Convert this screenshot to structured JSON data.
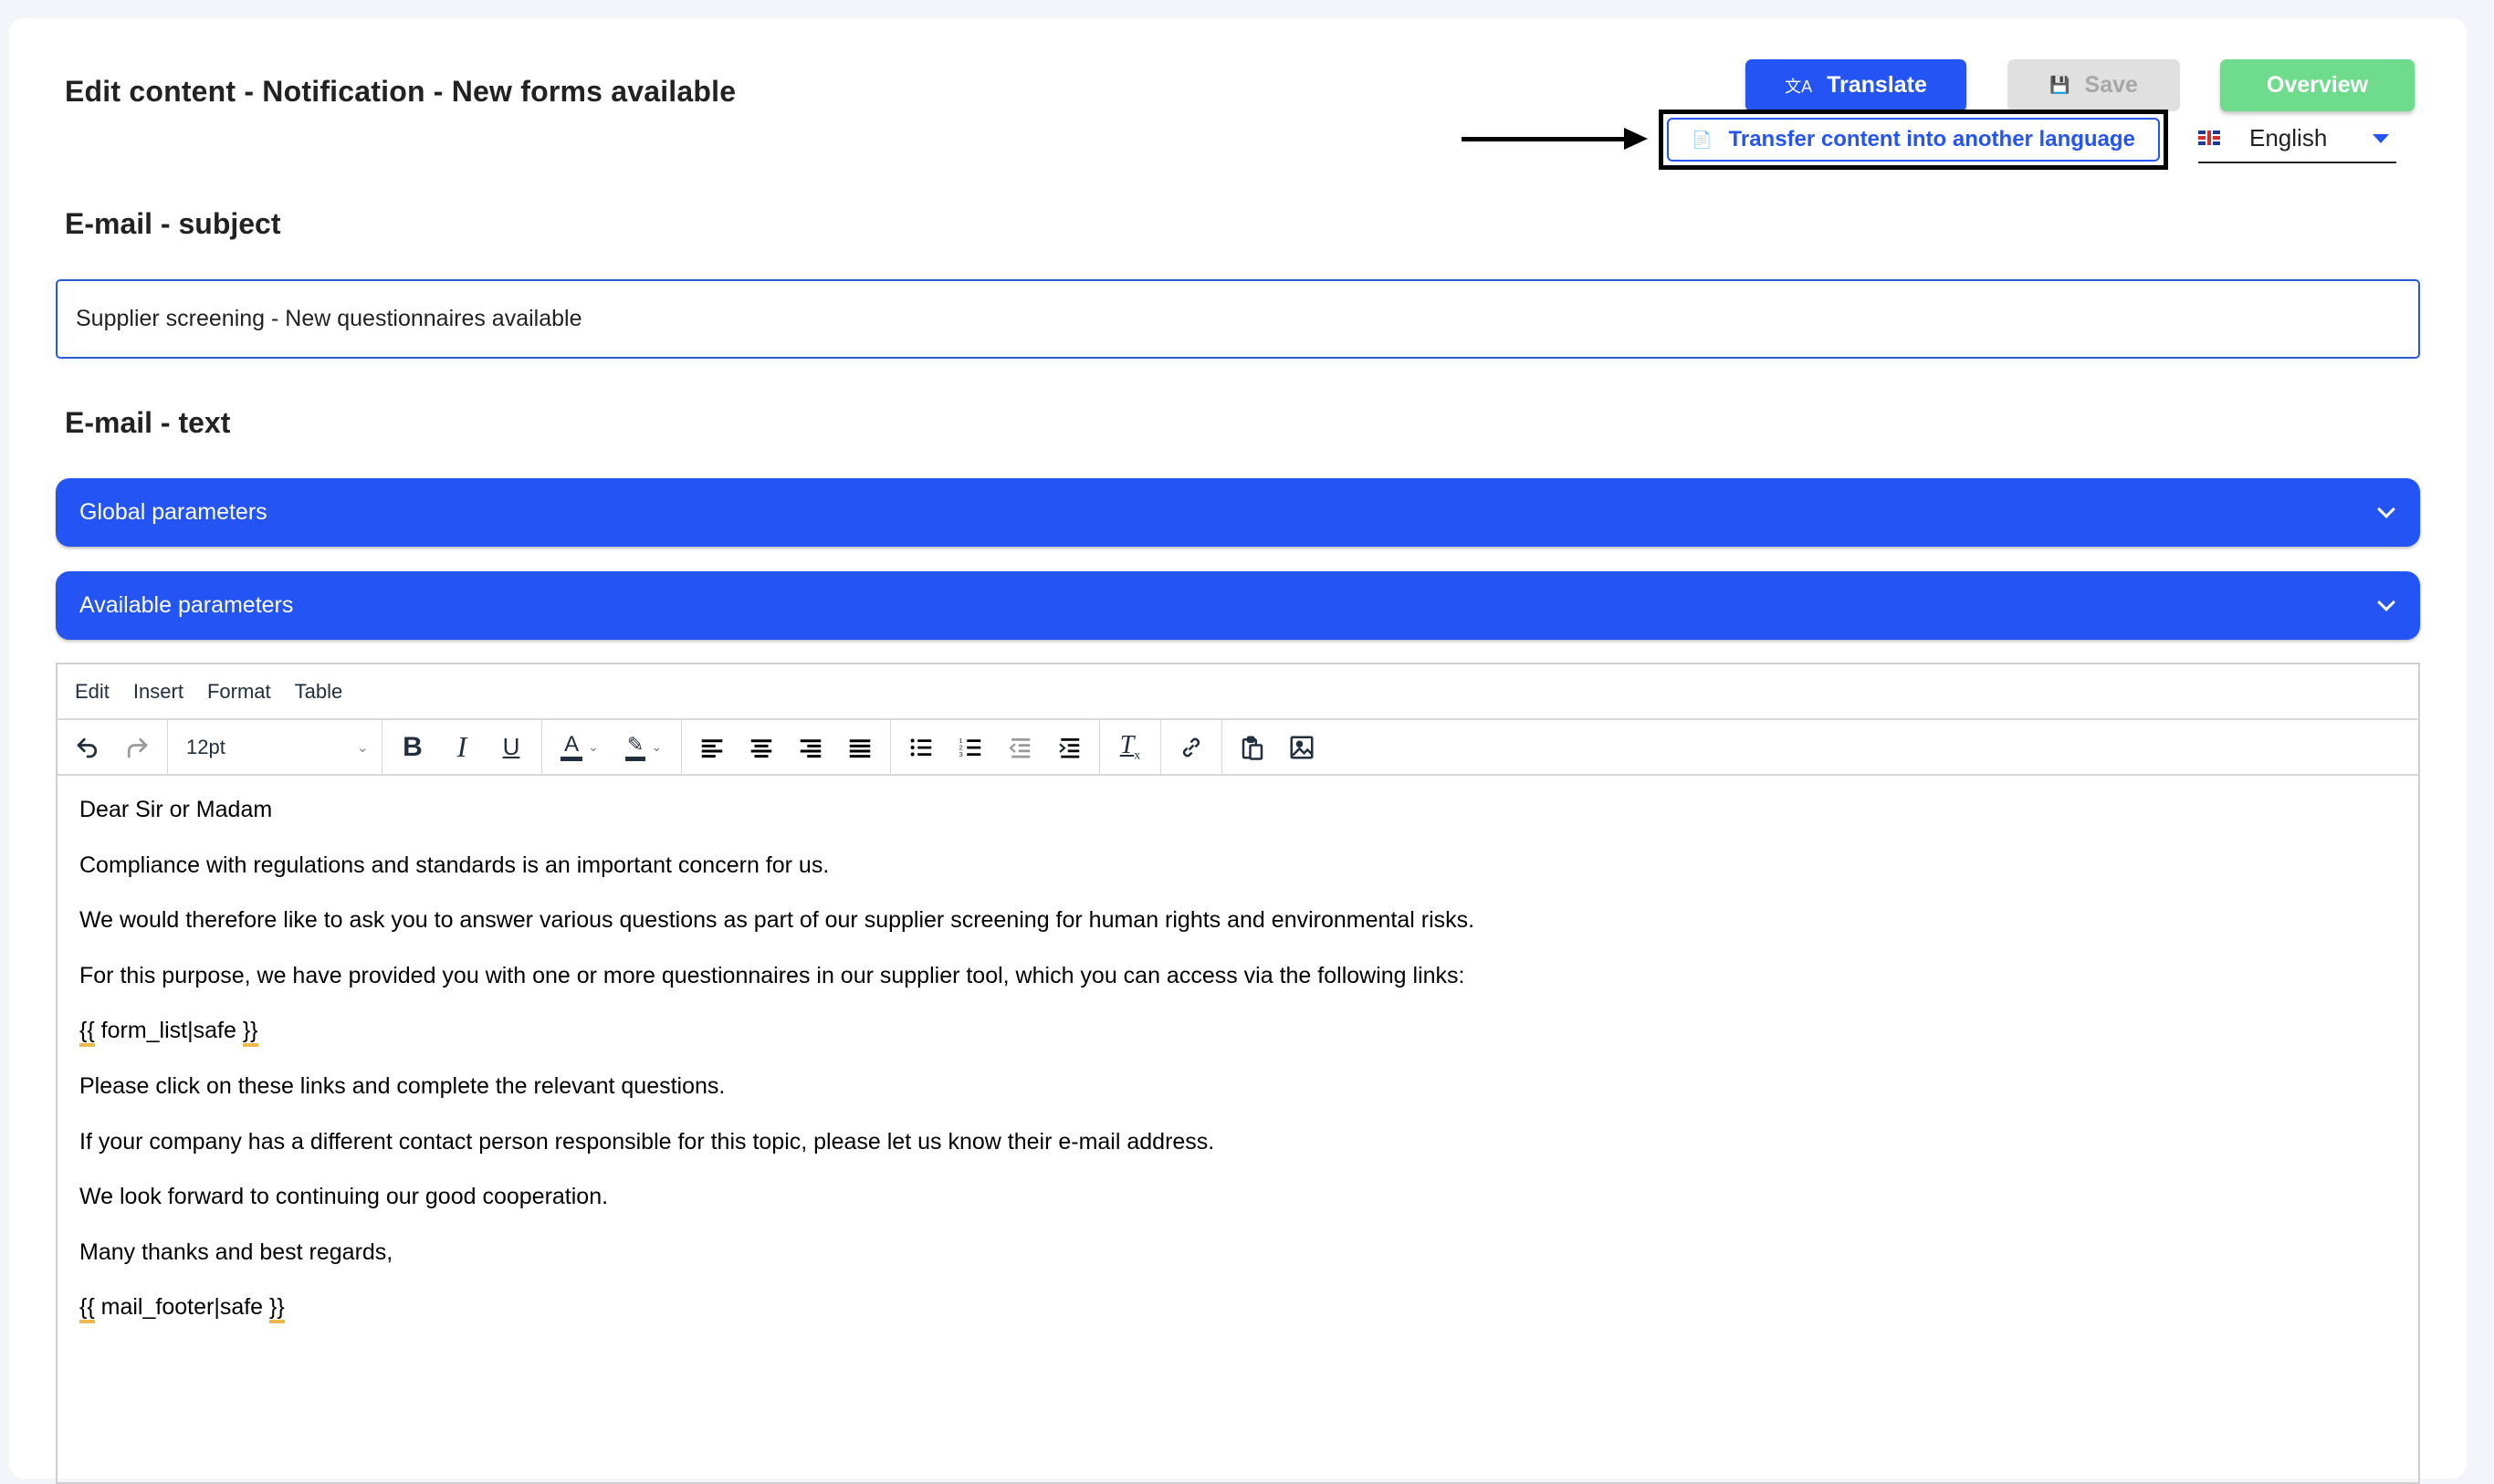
{
  "page": {
    "title": "Edit content - Notification - New forms available"
  },
  "header_actions": {
    "translate": {
      "label": "Translate",
      "icon": "translate-icon",
      "color": "#2455f4"
    },
    "save": {
      "label": "Save",
      "icon": "save-icon",
      "disabled": true
    },
    "overview": {
      "label": "Overview",
      "color": "#6edc8c"
    },
    "transfer": {
      "label": "Transfer content into another language",
      "icon": "copy-document-icon",
      "highlighted": true
    },
    "language": {
      "selected": "English",
      "flag": "uk-flag-icon"
    }
  },
  "subject": {
    "heading": "E-mail - subject",
    "value": "Supplier screening - New questionnaires available"
  },
  "text_section": {
    "heading": "E-mail - text",
    "accordions": [
      {
        "label": "Global parameters",
        "expanded": false
      },
      {
        "label": "Available parameters",
        "expanded": false
      }
    ]
  },
  "editor": {
    "menu": [
      "Edit",
      "Insert",
      "Format",
      "Table"
    ],
    "font_size": "12pt",
    "toolbar": [
      "undo",
      "redo",
      "font-size",
      "bold",
      "italic",
      "underline",
      "text-color",
      "highlight-color",
      "align-left",
      "align-center",
      "align-right",
      "justify",
      "bullet-list",
      "numbered-list",
      "outdent",
      "indent",
      "clear-formatting",
      "link",
      "paste",
      "image"
    ],
    "paragraphs": [
      "Dear Sir or Madam",
      "Compliance with regulations and standards is an important concern for us.",
      "We would therefore like to ask you to answer various questions as part of our supplier screening for human rights and environmental risks.",
      "For this purpose, we have provided you with one or more questionnaires in our supplier tool, which you can access via the following links:",
      "{{ form_list|safe }}",
      "Please click on these links and complete the relevant questions.",
      "If your company has a different contact person responsible for this topic, please let us know their e-mail address.",
      "We look forward to continuing our good cooperation.",
      "Many thanks and best regards,",
      "{{ mail_footer|safe }}"
    ],
    "template_vars": {
      "form_list": {
        "open": "{{",
        "body": " form_list|safe ",
        "close": "}}"
      },
      "mail_footer": {
        "open": "{{",
        "body": " mail_footer|safe ",
        "close": "}}"
      }
    }
  }
}
